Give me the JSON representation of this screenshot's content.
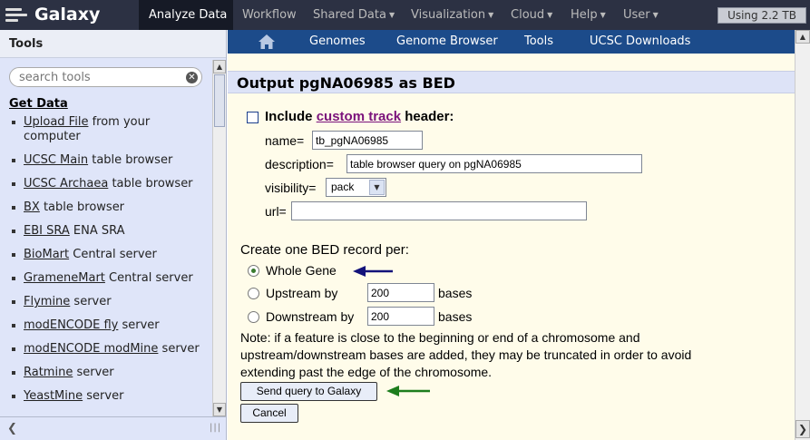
{
  "masthead": {
    "brand": "Galaxy",
    "nav": [
      {
        "label": "Analyze Data",
        "active": true,
        "dropdown": false
      },
      {
        "label": "Workflow",
        "active": false,
        "dropdown": false
      },
      {
        "label": "Shared Data",
        "active": false,
        "dropdown": true
      },
      {
        "label": "Visualization",
        "active": false,
        "dropdown": true
      },
      {
        "label": "Cloud",
        "active": false,
        "dropdown": true
      },
      {
        "label": "Help",
        "active": false,
        "dropdown": true
      },
      {
        "label": "User",
        "active": false,
        "dropdown": true
      }
    ],
    "quota": "Using 2.2 TB"
  },
  "tools_panel": {
    "title": "Tools",
    "search_placeholder": "search tools",
    "section": "Get Data",
    "items": [
      {
        "link": "Upload File",
        "rest": " from your computer"
      },
      {
        "link": "UCSC Main",
        "rest": " table browser"
      },
      {
        "link": "UCSC Archaea",
        "rest": " table browser"
      },
      {
        "link": "BX",
        "rest": " table browser"
      },
      {
        "link": "EBI SRA",
        "rest": " ENA SRA"
      },
      {
        "link": "BioMart",
        "rest": " Central server"
      },
      {
        "link": "GrameneMart",
        "rest": " Central server"
      },
      {
        "link": "Flymine",
        "rest": " server"
      },
      {
        "link": "modENCODE fly",
        "rest": " server"
      },
      {
        "link": "modENCODE modMine",
        "rest": " server"
      },
      {
        "link": "Ratmine",
        "rest": " server"
      },
      {
        "link": "YeastMine",
        "rest": " server"
      }
    ]
  },
  "ucsc": {
    "nav": [
      "Genomes",
      "Genome Browser",
      "Tools",
      "UCSC Downloads"
    ],
    "page_title": "Output pgNA06985 as BED",
    "include_prefix": "Include ",
    "custom_track": "custom track",
    "include_suffix": " header:",
    "name_label": "name=",
    "name_value": "tb_pgNA06985",
    "description_label": "description=",
    "description_value": "table browser query on pgNA06985",
    "visibility_label": "visibility=",
    "visibility_value": "pack",
    "url_label": "url=",
    "url_value": "",
    "record_heading": "Create one BED record per:",
    "options": [
      {
        "label": "Whole Gene",
        "selected": true
      },
      {
        "label": "Upstream by",
        "selected": false,
        "value": "200",
        "unit": "bases"
      },
      {
        "label": "Downstream by",
        "selected": false,
        "value": "200",
        "unit": "bases"
      }
    ],
    "note_lines": [
      "Note: if a feature is close to the beginning or end of a chromosome and",
      "upstream/downstream bases are added, they may be truncated in order to avoid",
      "extending past the edge of the chromosome."
    ],
    "send_button": "Send query to Galaxy",
    "cancel_button": "Cancel"
  },
  "colors": {
    "masthead": "#2c3143",
    "ucsc_nav": "#1c4b8a",
    "arrow_blue": "#13127a",
    "arrow_green": "#1d7d1d"
  }
}
